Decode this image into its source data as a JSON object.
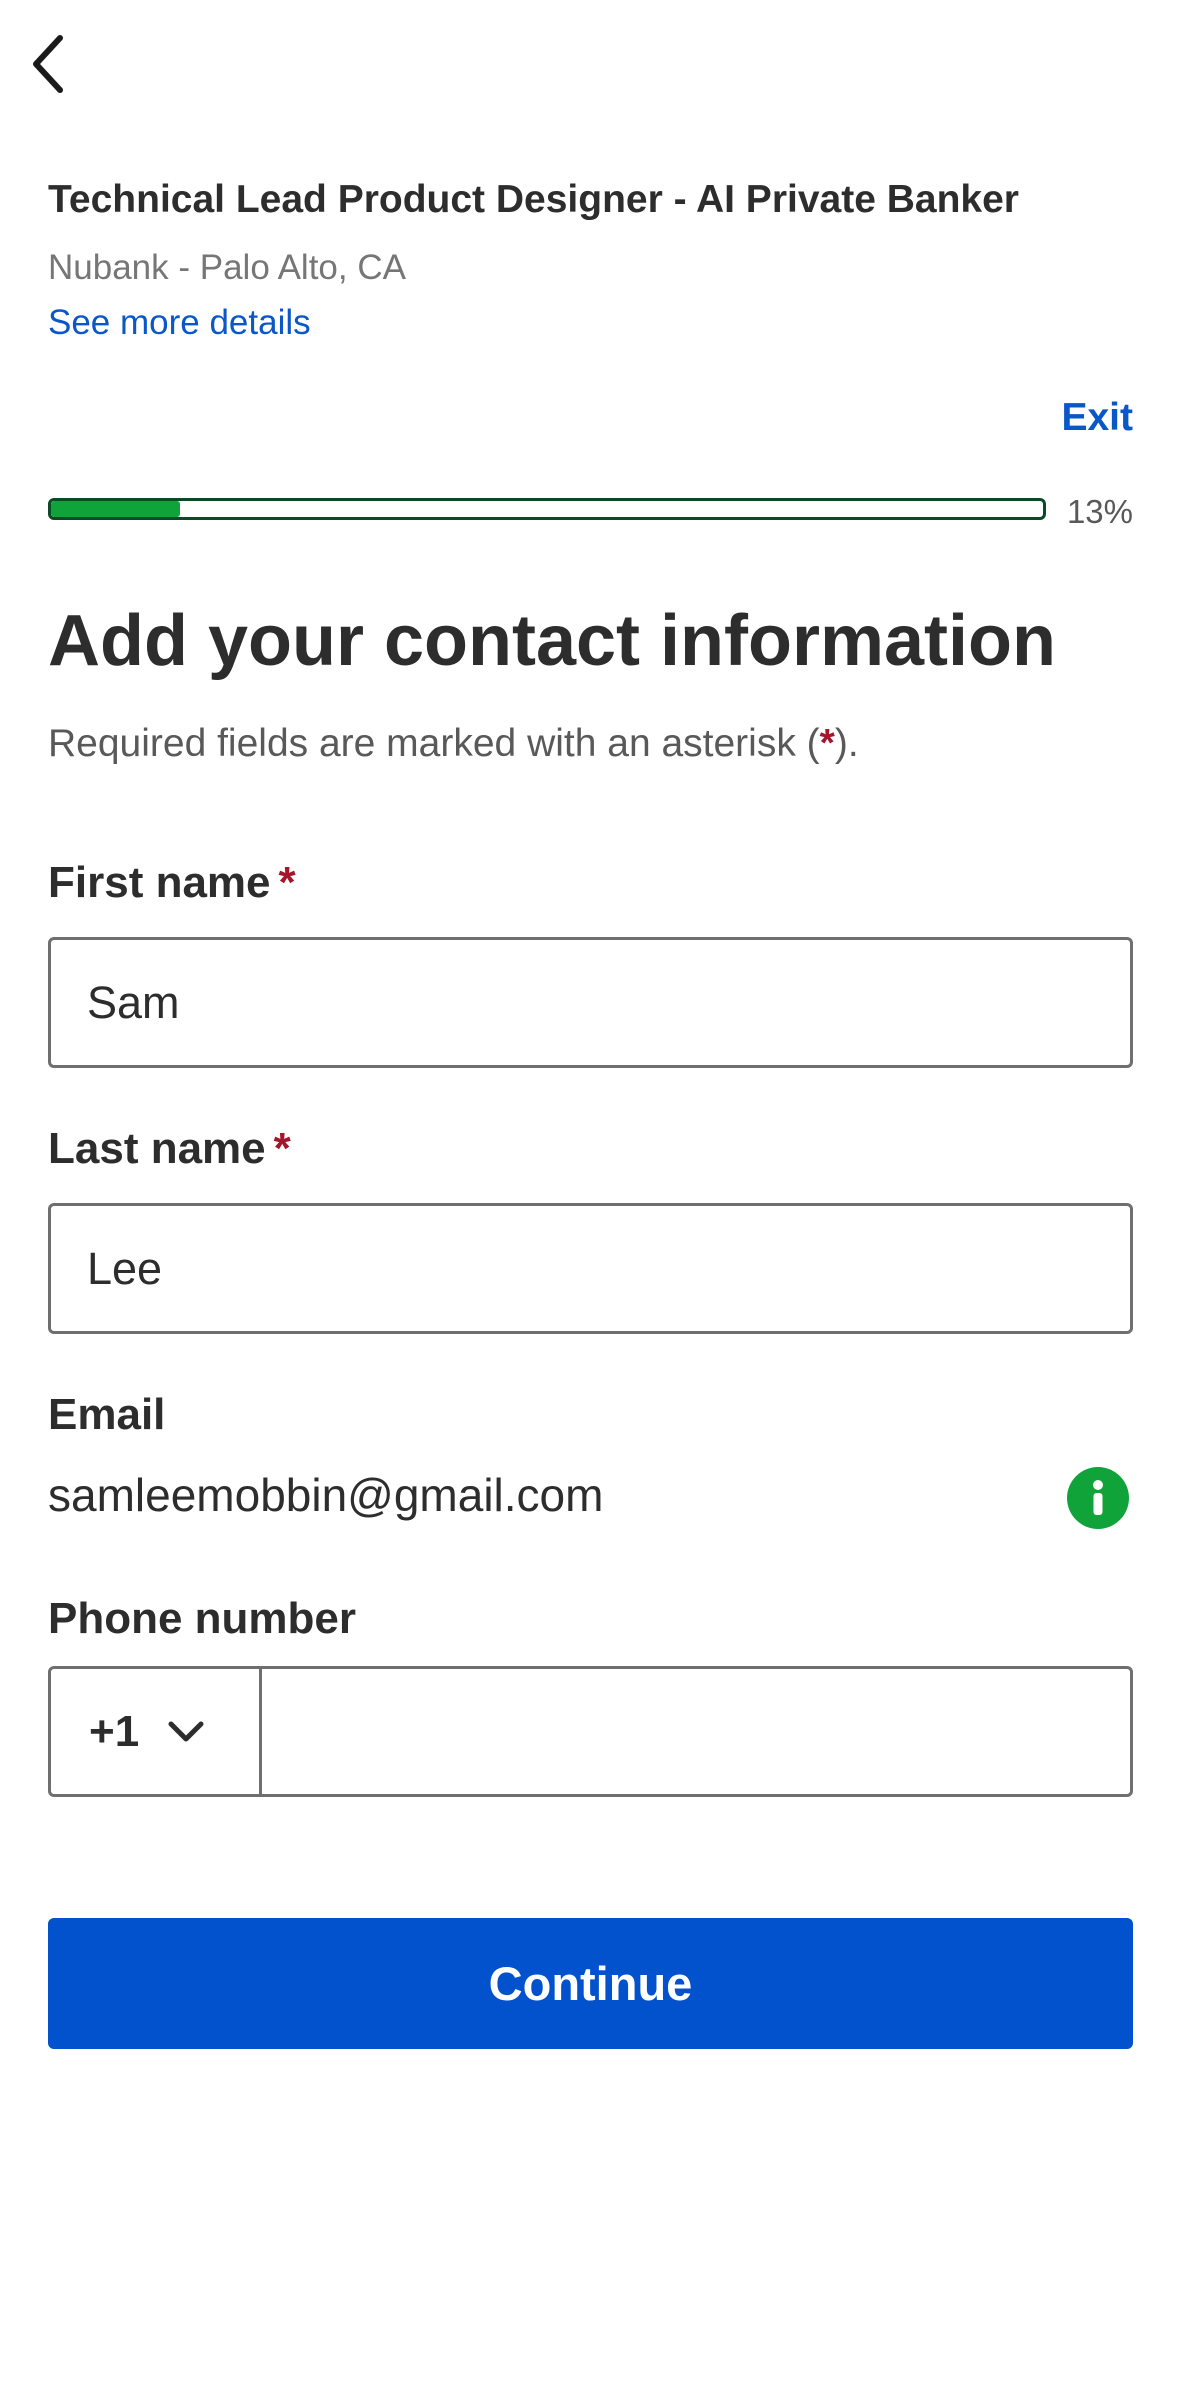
{
  "header": {
    "back_icon": "chevron-left-icon"
  },
  "job": {
    "title": "Technical Lead Product Designer - AI Private Banker",
    "company_location": "Nubank - Palo Alto, CA",
    "details_link": "See more details"
  },
  "progress": {
    "exit_label": "Exit",
    "percent": 13,
    "percent_label": "13%",
    "fill_color": "#0fa33a",
    "border_color": "#0b4a24"
  },
  "form": {
    "heading": "Add your contact information",
    "required_note_prefix": "Required fields are marked with an asterisk (",
    "required_asterisk": "*",
    "required_note_suffix": ").",
    "first_name": {
      "label": "First name",
      "asterisk": "*",
      "value": "Sam"
    },
    "last_name": {
      "label": "Last name",
      "asterisk": "*",
      "value": "Lee"
    },
    "email": {
      "label": "Email",
      "value": "samleemobbin@gmail.com",
      "info_icon": "info-icon",
      "info_color": "#0fa33a"
    },
    "phone": {
      "label": "Phone number",
      "country_code": "+1",
      "dropdown_icon": "chevron-down-icon",
      "value": ""
    },
    "continue_label": "Continue"
  },
  "colors": {
    "accent_blue": "#0152cc",
    "link_blue": "#0a57c8",
    "required_red": "#a3162b"
  }
}
